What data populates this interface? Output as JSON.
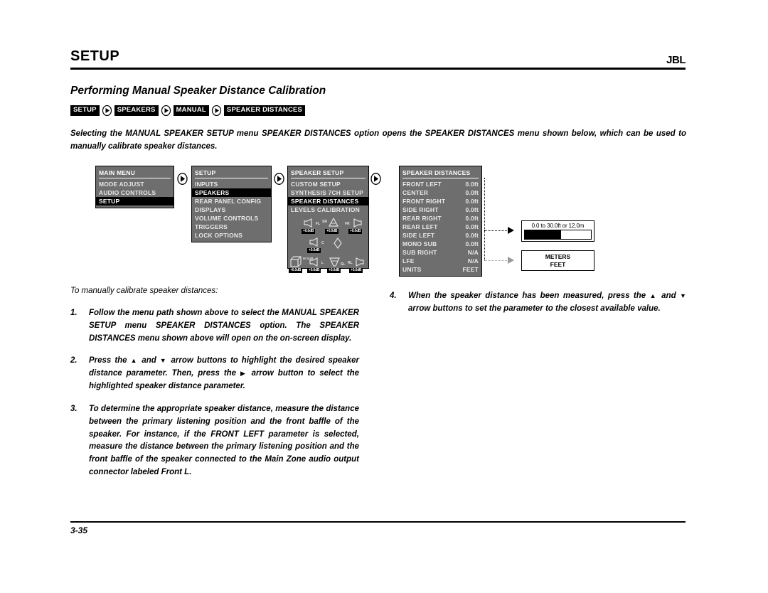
{
  "header": {
    "title": "SETUP",
    "logo": "JBL"
  },
  "subtitle": "Performing Manual Speaker Distance Calibration",
  "breadcrumb": {
    "items": [
      "SETUP",
      "SPEAKERS",
      "MANUAL",
      "SPEAKER DISTANCES"
    ]
  },
  "intro": "Selecting the MANUAL SPEAKER SETUP menu SPEAKER DISTANCES option opens the SPEAKER DISTANCES menu shown below, which can be used to manually calibrate speaker distances.",
  "menus": {
    "main": {
      "title": "MAIN MENU",
      "items": [
        {
          "label": "MODE ADJUST",
          "selected": false
        },
        {
          "label": "AUDIO CONTROLS",
          "selected": false
        },
        {
          "label": "SETUP",
          "selected": true
        }
      ]
    },
    "setup": {
      "title": "SETUP",
      "items": [
        {
          "label": "INPUTS",
          "selected": false
        },
        {
          "label": "SPEAKERS",
          "selected": true
        },
        {
          "label": "REAR PANEL CONFIG",
          "selected": false
        },
        {
          "label": "DISPLAYS",
          "selected": false
        },
        {
          "label": "VOLUME CONTROLS",
          "selected": false
        },
        {
          "label": "TRIGGERS",
          "selected": false
        },
        {
          "label": "LOCK OPTIONS",
          "selected": false
        }
      ]
    },
    "speaker_setup": {
      "title": "SPEAKER SETUP",
      "items": [
        {
          "label": "CUSTOM SETUP",
          "selected": false
        },
        {
          "label": "SYNTHESIS 7CH SETUP",
          "selected": false
        },
        {
          "label": "SPEAKER DISTANCES",
          "selected": true
        },
        {
          "label": "LEVELS CALIBRATION",
          "selected": false
        }
      ],
      "speaker_map": {
        "speakers": [
          {
            "name": "FL",
            "label": "FL",
            "db": "+0.0dB"
          },
          {
            "name": "SR",
            "label": "SR",
            "db": "+0.0dB"
          },
          {
            "name": "FR",
            "label": "FR",
            "db": "+0.0dB"
          },
          {
            "name": "C",
            "label": "C",
            "db": "+0.0dB"
          },
          {
            "name": "SUB",
            "label": "M SUB",
            "db": "+0.0dB"
          },
          {
            "name": "L",
            "label": "L",
            "db": "+0.0dB"
          },
          {
            "name": "SL",
            "label": "SL",
            "db": "+0.0dB"
          },
          {
            "name": "RL",
            "label": "RL",
            "db": "+0.0dB"
          }
        ]
      }
    },
    "speaker_distances": {
      "title": "SPEAKER DISTANCES",
      "rows": [
        {
          "label": "FRONT LEFT",
          "value": "0.0ft"
        },
        {
          "label": "CENTER",
          "value": "0.0ft"
        },
        {
          "label": "FRONT RIGHT",
          "value": "0.0ft"
        },
        {
          "label": "SIDE RIGHT",
          "value": "0.0ft"
        },
        {
          "label": "REAR RIGHT",
          "value": "0.0ft"
        },
        {
          "label": "REAR LEFT",
          "value": "0.0ft"
        },
        {
          "label": "SIDE LEFT",
          "value": "0.0ft"
        },
        {
          "label": "MONO SUB",
          "value": "0.0ft"
        },
        {
          "label": "SUB RIGHT",
          "value": "N/A"
        },
        {
          "label": "LFE",
          "value": "N/A"
        },
        {
          "label": "UNITS",
          "value": "FEET"
        }
      ]
    }
  },
  "callouts": {
    "range": {
      "text": "0.0 to 30.0ft or 12.0m",
      "fill_percent": 55
    },
    "units": {
      "option_1": "METERS",
      "option_2": "FEET"
    }
  },
  "lede": "To manually calibrate speaker distances:",
  "steps_left": [
    {
      "num": "1.",
      "text": "Follow the menu path shown above to select the MANUAL SPEAKER SETUP menu SPEAKER DISTANCES option. The SPEAKER DISTANCES menu shown above will open on the on-screen display."
    },
    {
      "num": "2.",
      "text_a": "Press the",
      "text_b": "and",
      "text_c": "arrow buttons to highlight the desired speaker distance parameter. Then, press the",
      "text_d": "arrow button to select the highlighted speaker distance parameter."
    },
    {
      "num": "3.",
      "text": "To determine the appropriate speaker distance, measure the distance between the primary listening position and the front baffle of the speaker. For instance, if the FRONT LEFT parameter is selected, measure the distance between the primary listening position and the front baffle of the speaker connected to the Main Zone audio output connector labeled Front L."
    }
  ],
  "steps_right": [
    {
      "num": "4.",
      "text_a": "When the speaker distance has been measured, press the",
      "text_b": "and",
      "text_c": "arrow buttons to set the parameter to the closest available value."
    }
  ],
  "footer": {
    "page": "3-35"
  }
}
